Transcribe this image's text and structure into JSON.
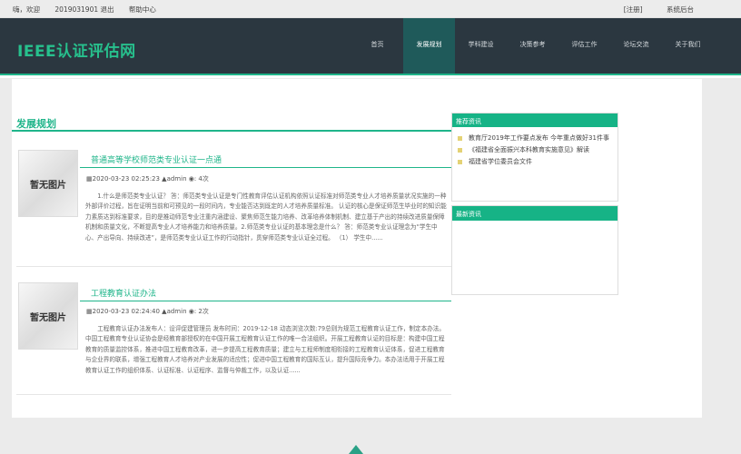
{
  "topbar": {
    "greeting": "嗨，欢迎",
    "user_id": "2019031901 退出",
    "help": "帮助中心",
    "register": "[注册]",
    "admin": "系统后台"
  },
  "header": {
    "logo": "IEEE认证评估网",
    "nav": [
      {
        "label": "首页",
        "active": false
      },
      {
        "label": "发展规划",
        "active": true
      },
      {
        "label": "学科建设",
        "active": false
      },
      {
        "label": "决策参考",
        "active": false
      },
      {
        "label": "评估工作",
        "active": false
      },
      {
        "label": "论坛交流",
        "active": false
      },
      {
        "label": "关于我们",
        "active": false
      }
    ]
  },
  "section": {
    "title": "发展规划"
  },
  "articles": [
    {
      "thumb_text": "暂无图片",
      "title": "普通高等学校师范类专业认证一点通",
      "meta": "▦2020-03-23 02:25:23 ▲admin ◉: 4次",
      "body": "1.什么是师范类专业认证？ 答：师范类专业认证是专门性教育评估认证机构依照认证标准对师范类专业人才培养质量状况实施的一种外部评价过程，旨在证明当前和可预见的一段时间内，专业能否达到既定的人才培养质量标准。 认证的核心是保证师范生毕业时的知识能力素质达到标准要求，目的是推动师范专业注重内涵建设、聚焦师范生能力培养、改革培养体制机制、建立基于产出的持续改进质量保障机制和质量文化，不断提高专业人才培养能力和培养质量。2.师范类专业认证的基本理念是什么？ 答：师范类专业认证理念为“学生中心、产出导向、持续改进”，是师范类专业认证工作的行动指针，贯穿师范类专业认证全过程。 （1） 学生中......"
    },
    {
      "thumb_text": "暂无图片",
      "title": "工程教育认证办法",
      "meta": "▦2020-03-23 02:24:40 ▲admin ◉: 2次",
      "body": "工程教育认证办法发布人：设评促建管理员  发布时间：2019-12-18  动态浏览次数:79总则为规范工程教育认证工作，制定本办法。中国工程教育专业认证协会是经教育部授权的在中国开展工程教育认证工作的唯一合法组织。开展工程教育认证的目标是：构建中国工程教育的质量监控体系，推进中国工程教育改革，进一步提高工程教育质量；建立与工程师制度相衔接的工程教育认证体系，促进工程教育与企业界的联系，增强工程教育人才培养对产业发展的适应性；促进中国工程教育的国际互认，提升国际竞争力。本办法适用于开展工程教育认证工作的组织体系、认证标准、认证程序、监督与仲裁工作，以及认证......"
    }
  ],
  "sidebar": {
    "recommend": {
      "title": "推荐资讯",
      "items": [
        "教育厅2019年工作要点发布 今年重点做好31件事",
        "《福建省全面振兴本科教育实施意见》解读",
        "福建省学位委员会文件"
      ]
    },
    "latest": {
      "title": "最新资讯",
      "items": []
    }
  }
}
